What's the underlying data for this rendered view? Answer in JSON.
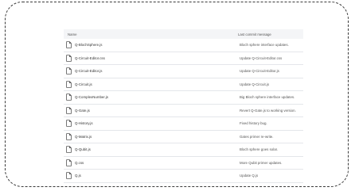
{
  "table": {
    "headers": {
      "name": "Name",
      "message": "Last commit message"
    },
    "rows": [
      {
        "name": "Q-BlochSphere.js",
        "message": "Bloch sphere interface updates."
      },
      {
        "name": "Q-Circuit-Editor.css",
        "message": "Update Q-Circuit-Editor.css"
      },
      {
        "name": "Q-Circuit-Editor.js",
        "message": "Update Q-Circuit-Editor.js"
      },
      {
        "name": "Q-Circuit.js",
        "message": "Update Q-Circuit.js"
      },
      {
        "name": "Q-ComplexNumber.js",
        "message": "Big Bloch sphere interface updates."
      },
      {
        "name": "Q-Gate.js",
        "message": "Revert Q-Gate.js to working version."
      },
      {
        "name": "Q-History.js",
        "message": "Fixed history bug."
      },
      {
        "name": "Q-Matrix.js",
        "message": "Gates primer re-write."
      },
      {
        "name": "Q-Qubit.js",
        "message": "Bloch sphere goes solar."
      },
      {
        "name": "Q.css",
        "message": "More Qubit primer updates."
      },
      {
        "name": "Q.js",
        "message": "Update Q.js"
      }
    ],
    "row_icon": "file-icon"
  }
}
